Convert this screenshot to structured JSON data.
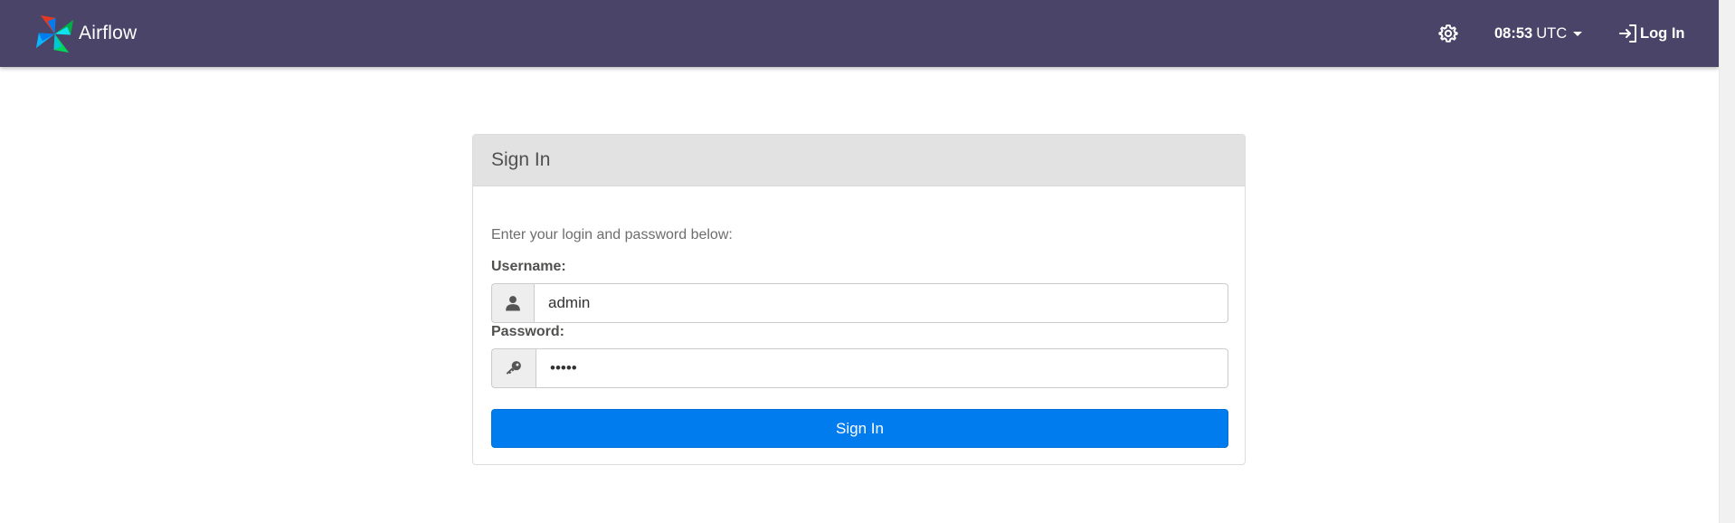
{
  "navbar": {
    "brand_name": "Airflow",
    "clock_time": "08:53",
    "clock_timezone": "UTC",
    "login_label": "Log In",
    "bg_color": "#4a4568"
  },
  "icons": {
    "logo": "airflow-pinwheel-icon",
    "settings": "gear-icon",
    "timezone_dropdown": "caret-down-icon",
    "login": "sign-in-icon",
    "username": "user-icon",
    "password": "key-icon"
  },
  "login_panel": {
    "title": "Sign In",
    "instructions": "Enter your login and password below:",
    "username_label": "Username:",
    "username_value": "admin",
    "password_label": "Password:",
    "password_value": "•••••",
    "submit_label": "Sign In",
    "submit_color": "#017cee"
  }
}
